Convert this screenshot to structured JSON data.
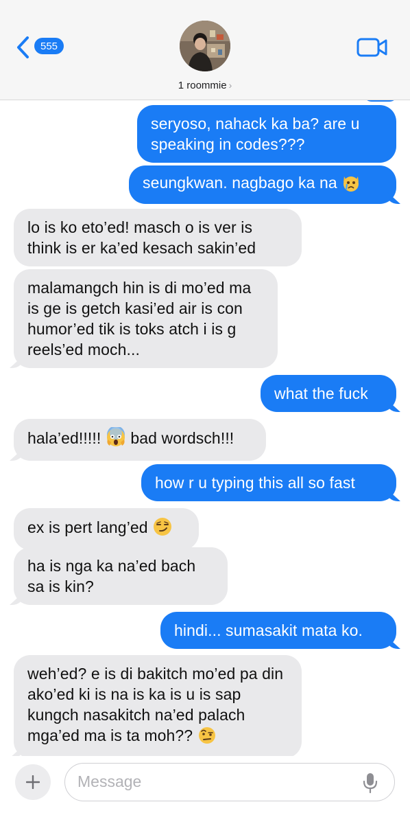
{
  "header": {
    "back_badge": "555",
    "contact_name": "1 roommie",
    "contact_chevron": "›",
    "icons": {
      "back": "chevron-left-icon",
      "video": "video-camera-icon"
    },
    "accent": "#1a7cf5"
  },
  "messages": [
    {
      "dir": "out",
      "text": "seryoso, nahack ka ba? are u speaking in codes???"
    },
    {
      "dir": "out",
      "text": "seungkwan. nagbago ka na ",
      "emoji": "crying-cat-emoji"
    },
    {
      "dir": "in",
      "text": "lo is ko eto’ed! masch o is ver is think is er ka’ed kesach sakin’ed"
    },
    {
      "dir": "in",
      "text": "malamangch hin is di mo’ed ma is ge is getch kasi’ed air is con humor’ed tik is toks atch i is g reels’ed moch..."
    },
    {
      "dir": "out",
      "text": "what the fuck"
    },
    {
      "dir": "in",
      "text": "hala’ed!!!!! ",
      "emoji": "screaming-face-emoji",
      "text2": " bad wordsch!!!"
    },
    {
      "dir": "out",
      "text": "how r u typing this all so fast"
    },
    {
      "dir": "in",
      "text": "ex is pert lang’ed ",
      "emoji": "smirking-face-emoji"
    },
    {
      "dir": "in",
      "text": "ha is nga ka na’ed bach sa is kin?"
    },
    {
      "dir": "out",
      "text": "hindi... sumasakit mata ko."
    },
    {
      "dir": "in",
      "text": "weh’ed? e is di bakitch mo’ed pa din ako’ed ki is na is ka is u is sap kungch nasakitch na’ed palach mga’ed ma is ta moh?? ",
      "emoji": "raised-eyebrow-emoji"
    }
  ],
  "composer": {
    "placeholder": "Message",
    "icons": {
      "add": "plus-icon",
      "mic": "microphone-icon"
    }
  },
  "colors": {
    "outgoing": "#1a7cf5",
    "incoming": "#e9e9eb"
  }
}
